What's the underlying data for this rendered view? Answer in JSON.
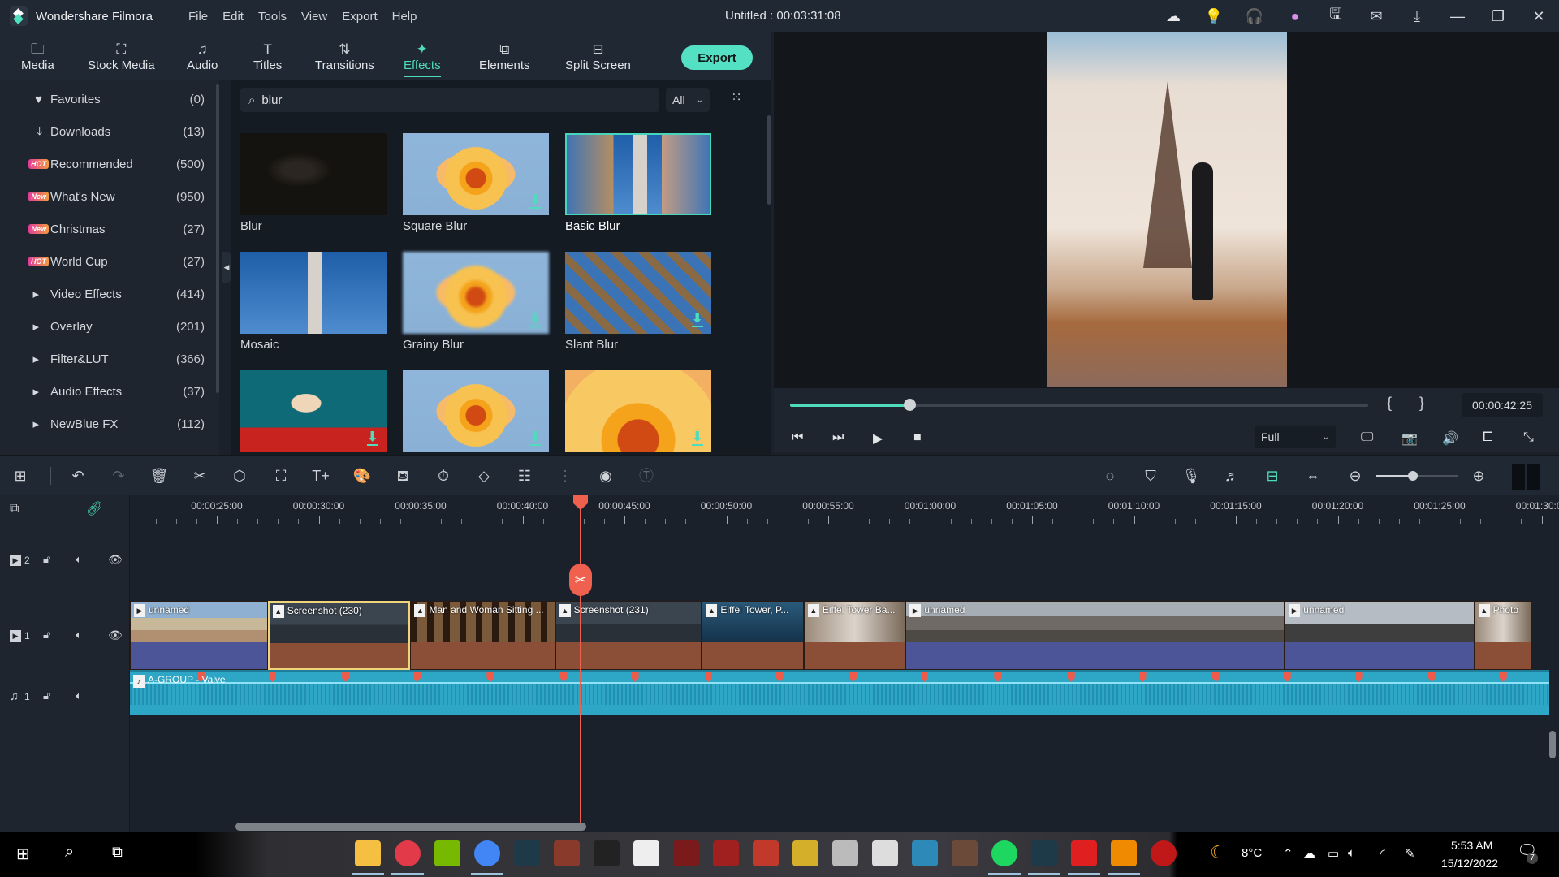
{
  "titlebar": {
    "app_name": "Wondershare Filmora",
    "menu": [
      "File",
      "Edit",
      "Tools",
      "View",
      "Export",
      "Help"
    ],
    "document_title": "Untitled : 00:03:31:08",
    "icons": [
      {
        "name": "cloud-icon",
        "glyph": "☁",
        "color": "#e6e8ea"
      },
      {
        "name": "lightbulb-icon",
        "glyph": "💡",
        "color": "#e8b93c"
      },
      {
        "name": "headset-icon",
        "glyph": "🎧",
        "color": "#45d6bb"
      },
      {
        "name": "avatar-icon",
        "glyph": "●",
        "color": "#d98ee8"
      },
      {
        "name": "save-icon",
        "glyph": "🖫",
        "color": "#d6d9de"
      },
      {
        "name": "mail-icon",
        "glyph": "✉",
        "color": "#d6d9de"
      },
      {
        "name": "download-icon",
        "glyph": "⤓",
        "color": "#d6d9de"
      },
      {
        "name": "minimize-icon",
        "glyph": "—",
        "color": "#d6d9de"
      },
      {
        "name": "restore-icon",
        "glyph": "❐",
        "color": "#d6d9de"
      },
      {
        "name": "close-icon",
        "glyph": "✕",
        "color": "#d6d9de"
      }
    ]
  },
  "tabs": [
    {
      "id": "media",
      "label": "Media",
      "glyph": "🗀",
      "active": false
    },
    {
      "id": "stock-media",
      "label": "Stock Media",
      "glyph": "⛶",
      "active": false
    },
    {
      "id": "audio",
      "label": "Audio",
      "glyph": "♫",
      "active": false
    },
    {
      "id": "titles",
      "label": "Titles",
      "glyph": "T",
      "active": false
    },
    {
      "id": "transitions",
      "label": "Transitions",
      "glyph": "⇅",
      "active": false
    },
    {
      "id": "effects",
      "label": "Effects",
      "glyph": "✦",
      "active": true
    },
    {
      "id": "elements",
      "label": "Elements",
      "glyph": "⧉",
      "active": false
    },
    {
      "id": "split-screen",
      "label": "Split Screen",
      "glyph": "⊟",
      "active": false
    }
  ],
  "export_label": "Export",
  "sidebar": {
    "items": [
      {
        "label": "Favorites",
        "count": "(0)",
        "lead": "heart"
      },
      {
        "label": "Downloads",
        "count": "(13)",
        "lead": "download"
      },
      {
        "label": "Recommended",
        "count": "(500)",
        "lead": "badge",
        "badge": "HOT"
      },
      {
        "label": "What's New",
        "count": "(950)",
        "lead": "badge",
        "badge": "New"
      },
      {
        "label": "Christmas",
        "count": "(27)",
        "lead": "badge",
        "badge": "New"
      },
      {
        "label": "World Cup",
        "count": "(27)",
        "lead": "badge",
        "badge": "HOT"
      },
      {
        "label": "Video Effects",
        "count": "(414)",
        "lead": "caret"
      },
      {
        "label": "Overlay",
        "count": "(201)",
        "lead": "caret"
      },
      {
        "label": "Filter&LUT",
        "count": "(366)",
        "lead": "caret"
      },
      {
        "label": "Audio Effects",
        "count": "(37)",
        "lead": "caret"
      },
      {
        "label": "NewBlue FX",
        "count": "(112)",
        "lead": "caret"
      }
    ]
  },
  "effects_panel": {
    "search_value": "blur",
    "filter_value": "All",
    "cards": [
      {
        "label": "Blur",
        "thumb": "dark-portrait",
        "download": false,
        "selected": false
      },
      {
        "label": "Square Blur",
        "thumb": "flower",
        "download": true,
        "selected": false
      },
      {
        "label": "Basic Blur",
        "thumb": "lighthouse-split",
        "download": false,
        "selected": true
      },
      {
        "label": "Mosaic",
        "thumb": "lighthouse",
        "download": false,
        "selected": false
      },
      {
        "label": "Grainy Blur",
        "thumb": "flower-blur",
        "download": true,
        "selected": false
      },
      {
        "label": "Slant Blur",
        "thumb": "lighthouse-slant",
        "download": true,
        "selected": false
      },
      {
        "label": "",
        "thumb": "woman-teal",
        "download": true,
        "selected": false
      },
      {
        "label": "",
        "thumb": "flower",
        "download": true,
        "selected": false
      },
      {
        "label": "",
        "thumb": "flower-zoom",
        "download": true,
        "selected": false
      }
    ]
  },
  "player": {
    "progress_fraction": 0.207,
    "mark_in": "{",
    "mark_out": "}",
    "timecode": "00:00:42:25",
    "quality": "Full",
    "controls": [
      {
        "name": "prev-frame-button",
        "glyph": "⏮"
      },
      {
        "name": "next-frame-button",
        "glyph": "⏭"
      },
      {
        "name": "play-button",
        "glyph": "▶"
      },
      {
        "name": "stop-button",
        "glyph": "■"
      }
    ],
    "right_controls": [
      {
        "name": "render-preview-button",
        "glyph": "🖵"
      },
      {
        "name": "snapshot-button",
        "glyph": "📷"
      },
      {
        "name": "volume-button",
        "glyph": "🔊"
      },
      {
        "name": "display-ratio-button",
        "glyph": "⧠"
      },
      {
        "name": "fullscreen-button",
        "glyph": "⤡"
      }
    ]
  },
  "timeline_toolbar": {
    "left_tools": [
      {
        "name": "layout-button",
        "glyph": "⊞",
        "dim": false
      },
      {
        "name": "undo-button",
        "glyph": "↶",
        "dim": false
      },
      {
        "name": "redo-button",
        "glyph": "↷",
        "dim": true
      },
      {
        "name": "delete-button",
        "glyph": "🗑",
        "dim": false
      },
      {
        "name": "cut-button",
        "glyph": "✂",
        "dim": false
      },
      {
        "name": "tag-button",
        "glyph": "⬡",
        "dim": false
      },
      {
        "name": "crop-button",
        "glyph": "⛶",
        "dim": false
      },
      {
        "name": "add-text-button",
        "glyph": "T+",
        "dim": false
      },
      {
        "name": "color-button",
        "glyph": "🎨",
        "dim": false
      },
      {
        "name": "green-screen-button",
        "glyph": "⛾",
        "dim": false
      },
      {
        "name": "speed-button",
        "glyph": "⏱",
        "dim": false
      },
      {
        "name": "keyframe-button",
        "glyph": "◇",
        "dim": false
      },
      {
        "name": "adjust-button",
        "glyph": "☷",
        "dim": false
      },
      {
        "name": "audio-mixer-button",
        "glyph": "⋮",
        "dim": true
      },
      {
        "name": "audio-stretch-button",
        "glyph": "◉",
        "dim": false
      },
      {
        "name": "speech-to-text-button",
        "glyph": "Ⓣ",
        "dim": true
      }
    ],
    "right_tools": [
      {
        "name": "render-button",
        "glyph": "◌",
        "accent": false
      },
      {
        "name": "marker-button",
        "glyph": "⛉",
        "accent": false
      },
      {
        "name": "record-voice-button",
        "glyph": "🎙",
        "accent": false
      },
      {
        "name": "audio-ducking-button",
        "glyph": "♬",
        "accent": false
      },
      {
        "name": "snap-button",
        "glyph": "⊟",
        "accent": true
      },
      {
        "name": "fit-timeline-button",
        "glyph": "⇔",
        "accent": false
      },
      {
        "name": "zoom-out-button",
        "glyph": "⊖",
        "accent": false
      },
      {
        "name": "zoom-in-button",
        "glyph": "⊕",
        "accent": false
      }
    ],
    "zoom_level_fraction": 0.45
  },
  "timeline": {
    "ruler_labels": [
      "00:00:25:00",
      "00:00:30:00",
      "00:00:35:00",
      "00:00:40:00",
      "00:00:45:00",
      "00:00:50:00",
      "00:00:55:00",
      "00:01:00:00",
      "00:01:05:00",
      "00:01:10:00",
      "00:01:15:00",
      "00:01:20:00",
      "00:01:25:00",
      "00:01:30:00"
    ],
    "playhead_time": "00:00:42:25",
    "tracks": [
      {
        "id": "video-2",
        "label": "2",
        "type": "video"
      },
      {
        "id": "video-1",
        "label": "1",
        "type": "video"
      },
      {
        "id": "audio-1",
        "label": "1",
        "type": "audio"
      }
    ],
    "video1_clips": [
      {
        "title": "unnamed",
        "kind": "video",
        "start": 20.0,
        "end": 27.5,
        "body": "#4b5597",
        "strip": "eiffel-day",
        "selected": false
      },
      {
        "title": "Screenshot (230)",
        "kind": "image",
        "start": 27.5,
        "end": 34.5,
        "body": "#8a4f36",
        "strip": "screen",
        "selected": true
      },
      {
        "title": "Man and Woman Sitting ...",
        "kind": "image",
        "start": 34.5,
        "end": 41.6,
        "body": "#8a4f36",
        "strip": "cafe",
        "selected": false
      },
      {
        "title": "Screenshot (231)",
        "kind": "image",
        "start": 41.6,
        "end": 48.8,
        "body": "#8a4f36",
        "strip": "screen",
        "selected": false
      },
      {
        "title": "Eiffel Tower, P...",
        "kind": "image",
        "start": 48.8,
        "end": 53.8,
        "body": "#8a4f36",
        "strip": "eiffel-blue",
        "selected": false
      },
      {
        "title": "Eiffel Tower Ba...",
        "kind": "image",
        "start": 53.8,
        "end": 58.8,
        "body": "#8a4f36",
        "strip": "street",
        "selected": false
      },
      {
        "title": "unnamed",
        "kind": "video",
        "start": 58.8,
        "end": 77.4,
        "body": "#4b5597",
        "strip": "paris-roofs",
        "selected": false
      },
      {
        "title": "unnamed",
        "kind": "video",
        "start": 77.4,
        "end": 86.7,
        "body": "#4b5597",
        "strip": "eiffel-gray",
        "selected": false
      },
      {
        "title": "Photo",
        "kind": "image",
        "start": 86.7,
        "end": 89.5,
        "body": "#8a4f36",
        "strip": "street",
        "selected": false
      }
    ],
    "audio_clip": {
      "title": "A-GROUP - Valve"
    },
    "beat_markers": [
      20.7,
      24.2,
      27.7,
      31.3,
      34.8,
      38.4,
      42.0,
      45.5,
      49.1,
      52.6,
      56.2,
      59.7,
      63.3,
      66.9,
      70.4,
      74.0,
      77.5,
      81.0,
      84.6,
      88.1
    ]
  },
  "taskbar": {
    "apps": [
      {
        "name": "file-explorer-icon",
        "color": "#f5c042",
        "active": true
      },
      {
        "name": "opera-icon",
        "color": "#e33a4a",
        "active": true
      },
      {
        "name": "nvidia-icon",
        "color": "#76b900",
        "active": false
      },
      {
        "name": "chrome-icon",
        "color": "#4285f4",
        "active": true
      },
      {
        "name": "filmora-icon",
        "color": "#1e3a48",
        "active": false
      },
      {
        "name": "game-icon-1",
        "color": "#8a3a2a",
        "active": false
      },
      {
        "name": "batman-icon",
        "color": "#222",
        "active": false
      },
      {
        "name": "dying-light-icon",
        "color": "#eee",
        "active": false
      },
      {
        "name": "evil-west-icon",
        "color": "#7a1a1a",
        "active": false
      },
      {
        "name": "rdr2-icon",
        "color": "#a02020",
        "active": false
      },
      {
        "name": "game-icon-2",
        "color": "#c0392b",
        "active": false
      },
      {
        "name": "game-icon-3",
        "color": "#d4b02a",
        "active": false
      },
      {
        "name": "witcher-icon",
        "color": "#bbb",
        "active": false
      },
      {
        "name": "crosshair-icon",
        "color": "#ddd",
        "active": false
      },
      {
        "name": "game-icon-4",
        "color": "#2d8ab8",
        "active": false
      },
      {
        "name": "game-icon-5",
        "color": "#6b4a3a",
        "active": false
      },
      {
        "name": "spotify-icon",
        "color": "#1ed760",
        "active": true
      },
      {
        "name": "filmora-active-icon",
        "color": "#1e3a48",
        "active": true
      },
      {
        "name": "wps-icon",
        "color": "#e02020",
        "active": true
      },
      {
        "name": "vlc-icon",
        "color": "#f08a00",
        "active": true
      },
      {
        "name": "game-icon-6",
        "color": "#c01818",
        "active": false
      }
    ],
    "weather_temp": "8°C",
    "time": "5:53 AM",
    "date": "15/12/2022",
    "notification_count": "7"
  }
}
